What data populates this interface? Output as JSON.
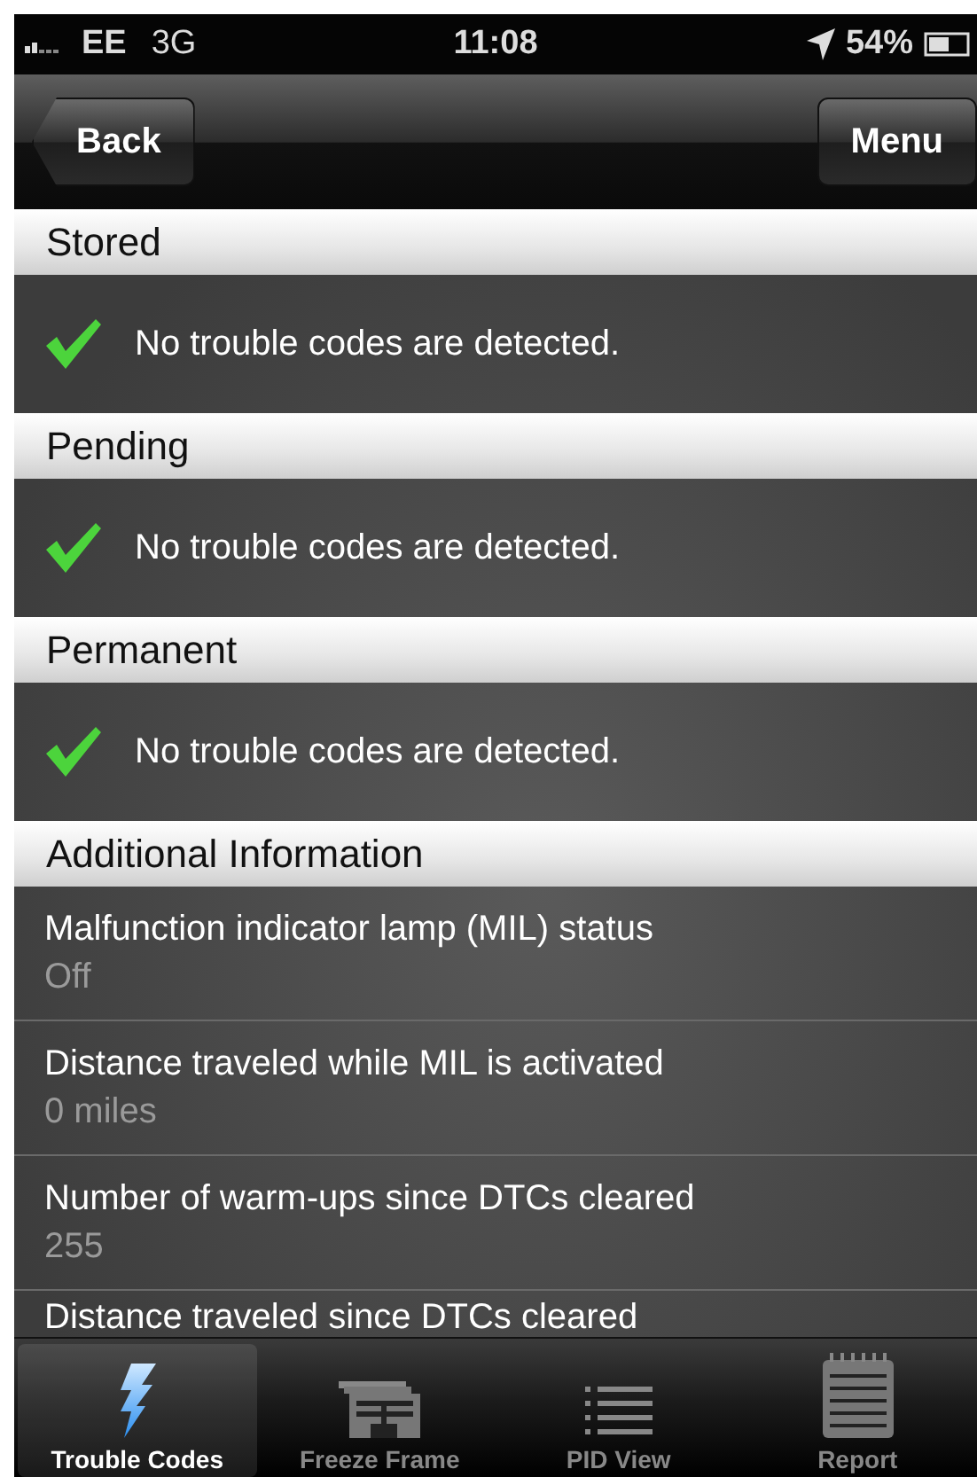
{
  "status_bar": {
    "carrier": "EE",
    "network": "3G",
    "time": "11:08",
    "battery": "54%"
  },
  "nav_bar": {
    "back": "Back",
    "menu": "Menu"
  },
  "sections": [
    {
      "title": "Stored",
      "items": [
        {
          "kind": "ok",
          "text": "No trouble codes are detected."
        }
      ]
    },
    {
      "title": "Pending",
      "items": [
        {
          "kind": "ok",
          "text": "No trouble codes are detected."
        }
      ]
    },
    {
      "title": "Permanent",
      "items": [
        {
          "kind": "ok",
          "text": "No trouble codes are detected."
        }
      ]
    },
    {
      "title": "Additional Information",
      "items": [
        {
          "kind": "info",
          "text": "Malfunction indicator lamp (MIL) status",
          "value": "Off"
        },
        {
          "kind": "info",
          "text": "Distance traveled while MIL is activated",
          "value": "0 miles"
        },
        {
          "kind": "info",
          "text": "Number of warm-ups since DTCs cleared",
          "value": "255"
        },
        {
          "kind": "info",
          "text": "Distance traveled since DTCs cleared"
        }
      ]
    }
  ],
  "tab_bar": [
    {
      "label": "Trouble Codes",
      "kind": "bolt",
      "selected": true
    },
    {
      "label": "Freeze Frame",
      "kind": "frames",
      "selected": false
    },
    {
      "label": "PID View",
      "kind": "list",
      "selected": false
    },
    {
      "label": "Report",
      "kind": "notepad",
      "selected": false
    }
  ]
}
